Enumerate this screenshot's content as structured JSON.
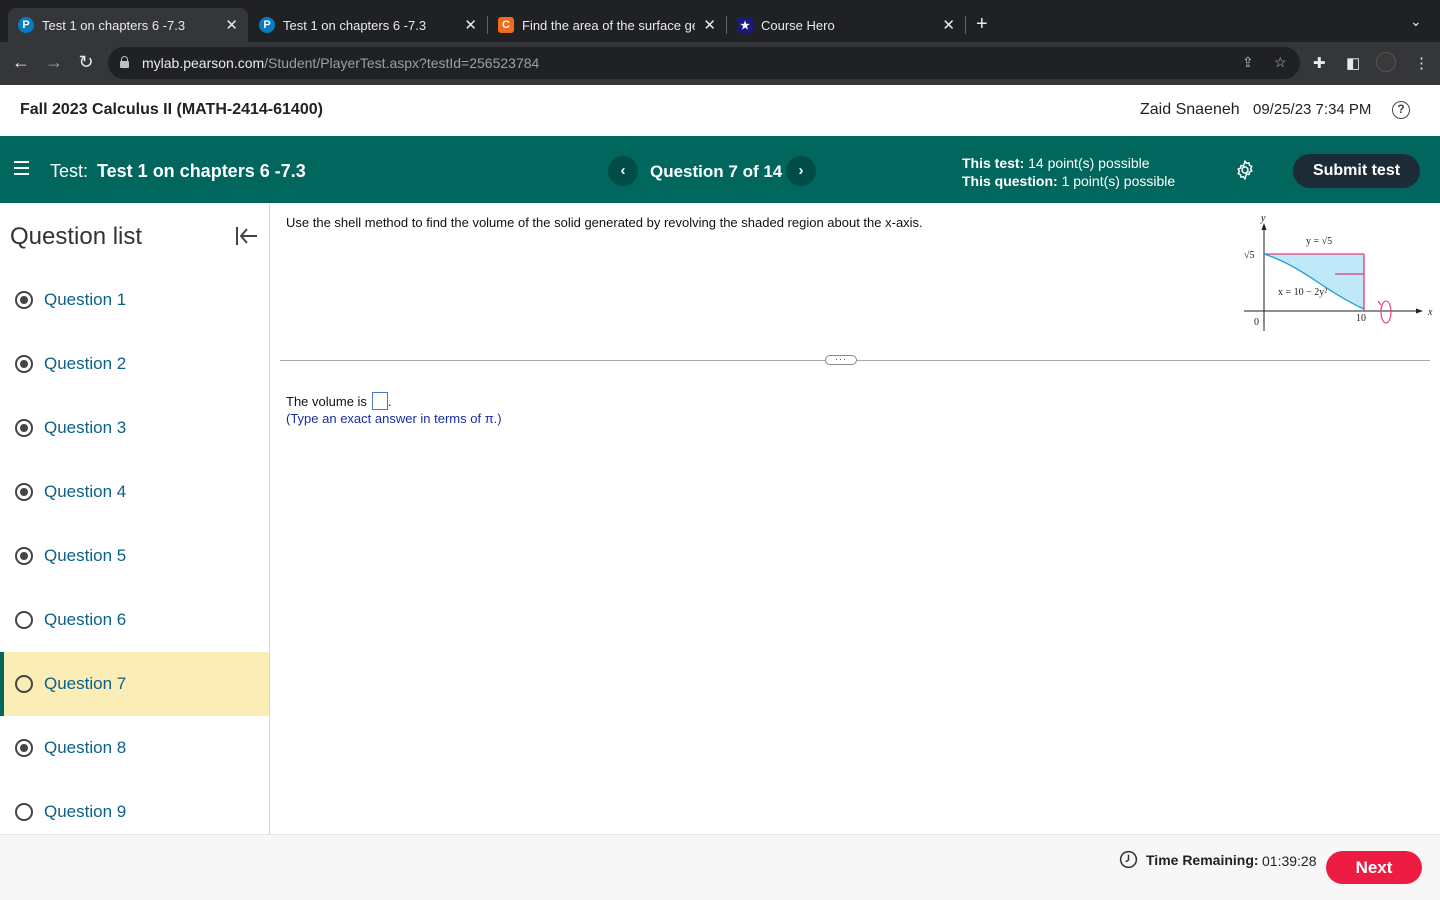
{
  "browser": {
    "tabs": [
      {
        "title": "Test 1 on chapters 6 -7.3",
        "icon": "pearson-icon",
        "active": true
      },
      {
        "title": "Test 1 on chapters 6 -7.3",
        "icon": "pearson-icon",
        "active": false
      },
      {
        "title": "Find the area of the surface ge",
        "icon": "chegg-icon",
        "active": false
      },
      {
        "title": "Course Hero",
        "icon": "coursehero-icon",
        "active": false
      }
    ],
    "url_host": "mylab.pearson.com",
    "url_path": "/Student/PlayerTest.aspx?testId=256523784"
  },
  "header": {
    "course_title": "Fall 2023 Calculus II (MATH-2414-61400)",
    "user_name": "Zaid Snaeneh",
    "datetime": "09/25/23 7:34 PM"
  },
  "testbar": {
    "test_prefix": "Test:",
    "test_name": "Test 1 on chapters 6 -7.3",
    "question_indicator": "Question 7 of 14",
    "this_test_label": "This test:",
    "this_test_value": "14 point(s) possible",
    "this_question_label": "This question:",
    "this_question_value": "1 point(s) possible",
    "submit_label": "Submit test"
  },
  "sidebar": {
    "title": "Question list",
    "items": [
      {
        "label": "Question 1",
        "answered": true
      },
      {
        "label": "Question 2",
        "answered": true
      },
      {
        "label": "Question 3",
        "answered": true
      },
      {
        "label": "Question 4",
        "answered": true
      },
      {
        "label": "Question 5",
        "answered": true
      },
      {
        "label": "Question 6",
        "answered": false
      },
      {
        "label": "Question 7",
        "answered": false,
        "current": true
      },
      {
        "label": "Question 8",
        "answered": true
      },
      {
        "label": "Question 9",
        "answered": false
      }
    ]
  },
  "question": {
    "prompt": "Use the shell method to find the volume of the solid generated by revolving the shaded region about the x-axis.",
    "answer_prefix": "The volume is",
    "answer_suffix": ".",
    "hint": "(Type an exact answer in terms of π.)",
    "figure": {
      "y_axis_label": "y",
      "x_axis_label": "x",
      "top_line_label": "y = √5",
      "curve_label": "x = 10 − 2y²",
      "y_tick": "√5",
      "origin_label": "0",
      "x_tick": "10"
    }
  },
  "footer": {
    "time_label": "Time Remaining:",
    "time_value": "01:39:28",
    "next_label": "Next"
  }
}
